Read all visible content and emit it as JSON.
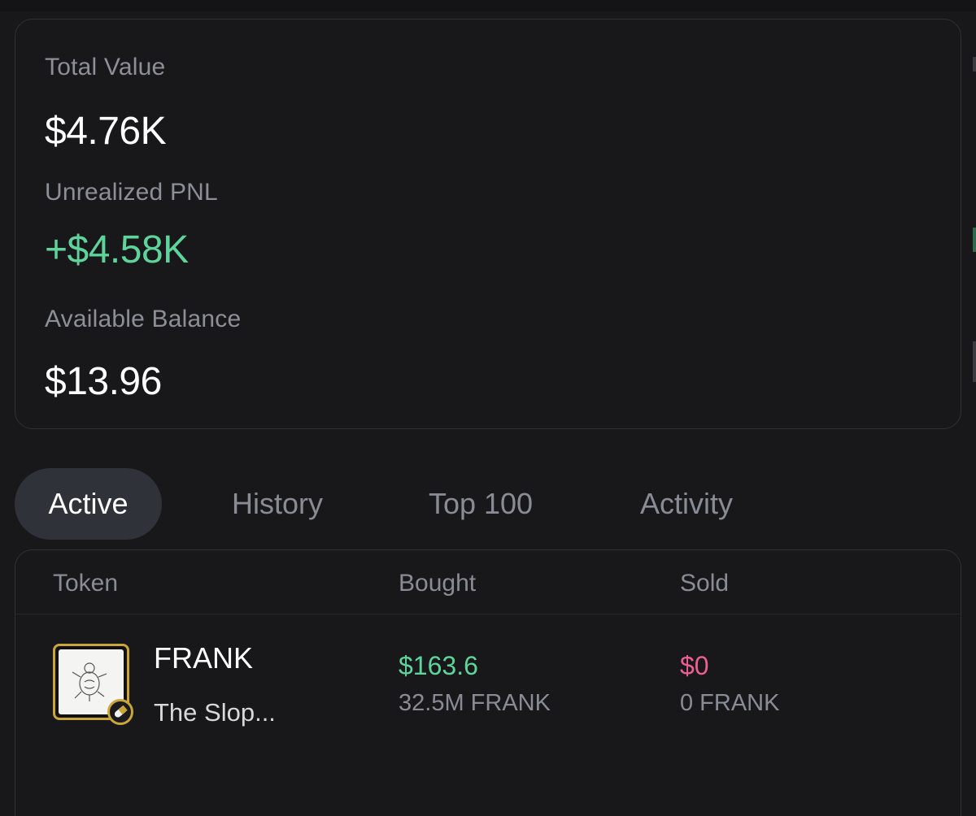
{
  "summary": {
    "total_value_label": "Total Value",
    "total_value": "$4.76K",
    "pnl_label": "Unrealized PNL",
    "pnl_value": "+$4.58K",
    "balance_label": "Available Balance",
    "balance_value": "$13.96"
  },
  "tabs": [
    "Active",
    "History",
    "Top 100",
    "Activity"
  ],
  "active_tab": "Active",
  "table": {
    "headers": {
      "token": "Token",
      "bought": "Bought",
      "sold": "Sold"
    },
    "rows": [
      {
        "symbol": "FRANK",
        "name": "The Slop...",
        "bought_value": "$163.6",
        "bought_amount": "32.5M FRANK",
        "sold_value": "$0",
        "sold_amount": "0 FRANK"
      }
    ]
  },
  "colors": {
    "background": "#18181b",
    "positive": "#5fd49a",
    "negative": "#ec5f92",
    "token_border": "#c9a53a"
  }
}
